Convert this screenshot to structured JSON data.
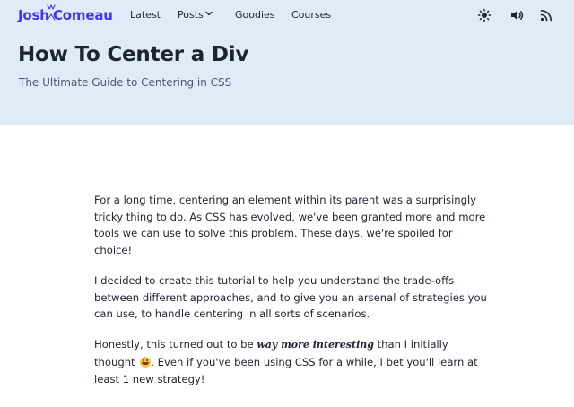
{
  "header": {
    "logo": {
      "first": "Josh",
      "last": "Comeau"
    },
    "nav": [
      {
        "label": "Latest"
      },
      {
        "label": "Posts",
        "has_dropdown": true
      },
      {
        "label": "Goodies"
      },
      {
        "label": "Courses"
      }
    ],
    "icons": [
      "sun-icon",
      "speaker-icon",
      "rss-icon"
    ]
  },
  "hero": {
    "title": "How To Center a Div",
    "subtitle": "The Ultimate Guide to Centering in CSS",
    "background_color": "#e3ecf6"
  },
  "article": {
    "p1": "For a long time, centering an element within its parent was a surprisingly tricky thing to do. As CSS has evolved, we've been granted more and more tools we can use to solve this problem. These days, we're spoiled for choice!",
    "p2": "I decided to create this tutorial to help you understand the trade-offs between different approaches, and to give you an arsenal of strategies you can use, to handle centering in all sorts of scenarios.",
    "p3_before": "Honestly, this turned out to be ",
    "p3_emphasis": "way more interesting",
    "p3_after": " than I initially thought ",
    "p3_emoji": "grinning-sweat-emoji",
    "p3_end": ". Even if you've been using CSS for a while, I bet you'll learn at least 1 new strategy!"
  },
  "colors": {
    "brand": "#3a33ff",
    "text": "#1f2433",
    "subtitle": "#4c5872"
  }
}
